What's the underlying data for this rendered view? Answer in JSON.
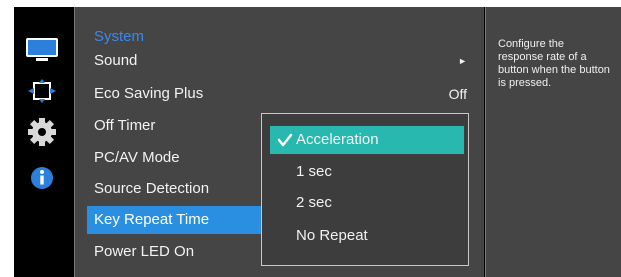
{
  "menu": {
    "items": [
      {
        "label": "System"
      },
      {
        "label": "Sound",
        "arrow": "►"
      },
      {
        "label": "Eco Saving Plus",
        "value": "Off"
      },
      {
        "label": "Off Timer"
      },
      {
        "label": "PC/AV Mode"
      },
      {
        "label": "Source Detection"
      },
      {
        "label": "Key Repeat Time"
      },
      {
        "label": "Power LED On"
      }
    ]
  },
  "popup": {
    "options": [
      "Acceleration",
      "1 sec",
      "2 sec",
      "No Repeat"
    ],
    "selected": "Acceleration"
  },
  "info": {
    "text": "Configure the response rate of a button when the button is pressed."
  },
  "icons": [
    "monitor-icon",
    "size-position-icon",
    "gear-icon",
    "info-icon"
  ],
  "colors": {
    "panel": "#454545",
    "title": "#3d88e8",
    "selected_item": "#2a8fe0",
    "selected_option": "#28b8b0"
  }
}
